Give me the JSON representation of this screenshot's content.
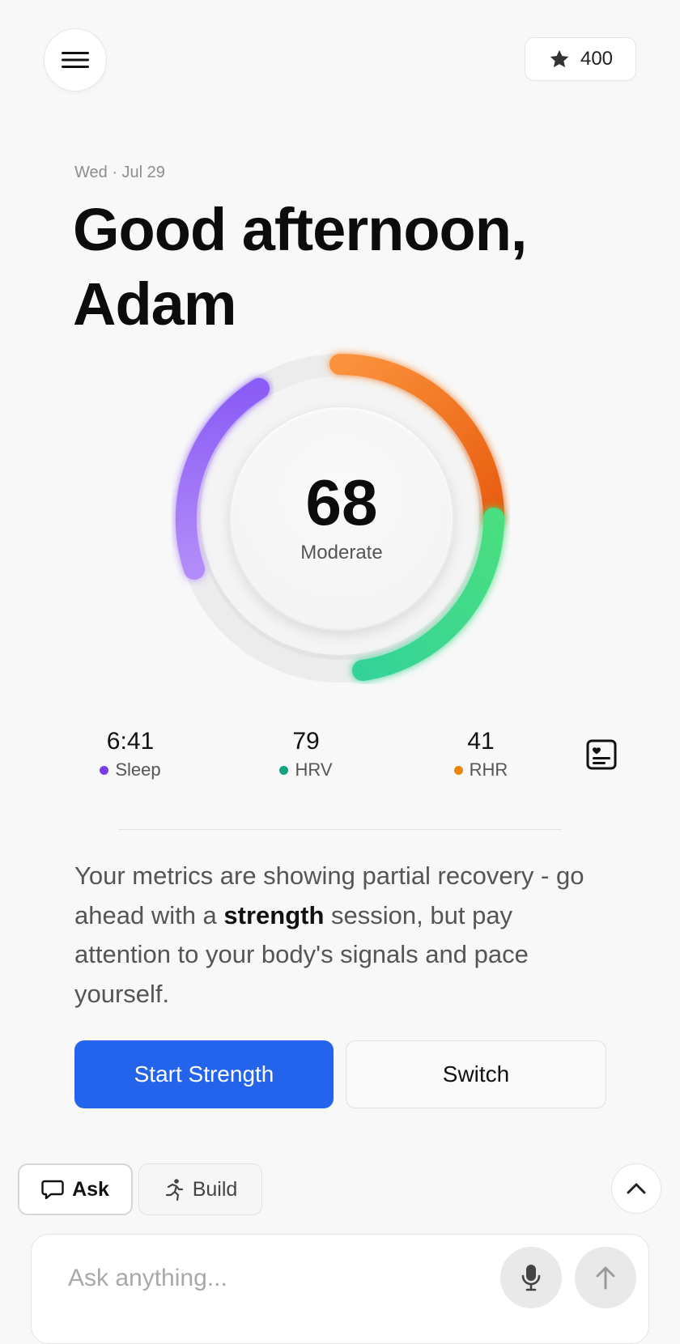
{
  "header": {
    "menu_icon": "hamburger-menu-icon",
    "points_icon": "star-icon",
    "points": "400"
  },
  "date": "Wed · Jul 29",
  "greeting": {
    "line1": "Good afternoon,",
    "line2": "Adam"
  },
  "recovery": {
    "score": "68",
    "label": "Moderate",
    "segments": [
      {
        "name": "Sleep",
        "color": "#8b5cf6"
      },
      {
        "name": "RHR",
        "color": "#f97316"
      },
      {
        "name": "HRV",
        "color": "#34d399"
      }
    ]
  },
  "stats": [
    {
      "value": "6:41",
      "label": "Sleep",
      "color": "#7c3aed"
    },
    {
      "value": "79",
      "label": "HRV",
      "color": "#10a37f"
    },
    {
      "value": "41",
      "label": "RHR",
      "color": "#e8850a"
    }
  ],
  "report_icon": "health-report-icon",
  "advice": {
    "before": "Your metrics are showing partial recovery - go ahead with a ",
    "bold": "strength",
    "after": " session, but pay attention to your body's signals and pace yourself."
  },
  "actions": {
    "primary": "Start Strength",
    "secondary": "Switch"
  },
  "tabs": {
    "ask": "Ask",
    "ask_icon": "chat-bubble-icon",
    "build": "Build",
    "build_icon": "running-figure-icon"
  },
  "composer": {
    "placeholder": "Ask anything...",
    "mic_icon": "microphone-icon",
    "send_icon": "arrow-up-icon",
    "collapse_icon": "chevron-up-icon"
  },
  "colors": {
    "accent": "#2463eb",
    "background": "#f8f8f8"
  }
}
